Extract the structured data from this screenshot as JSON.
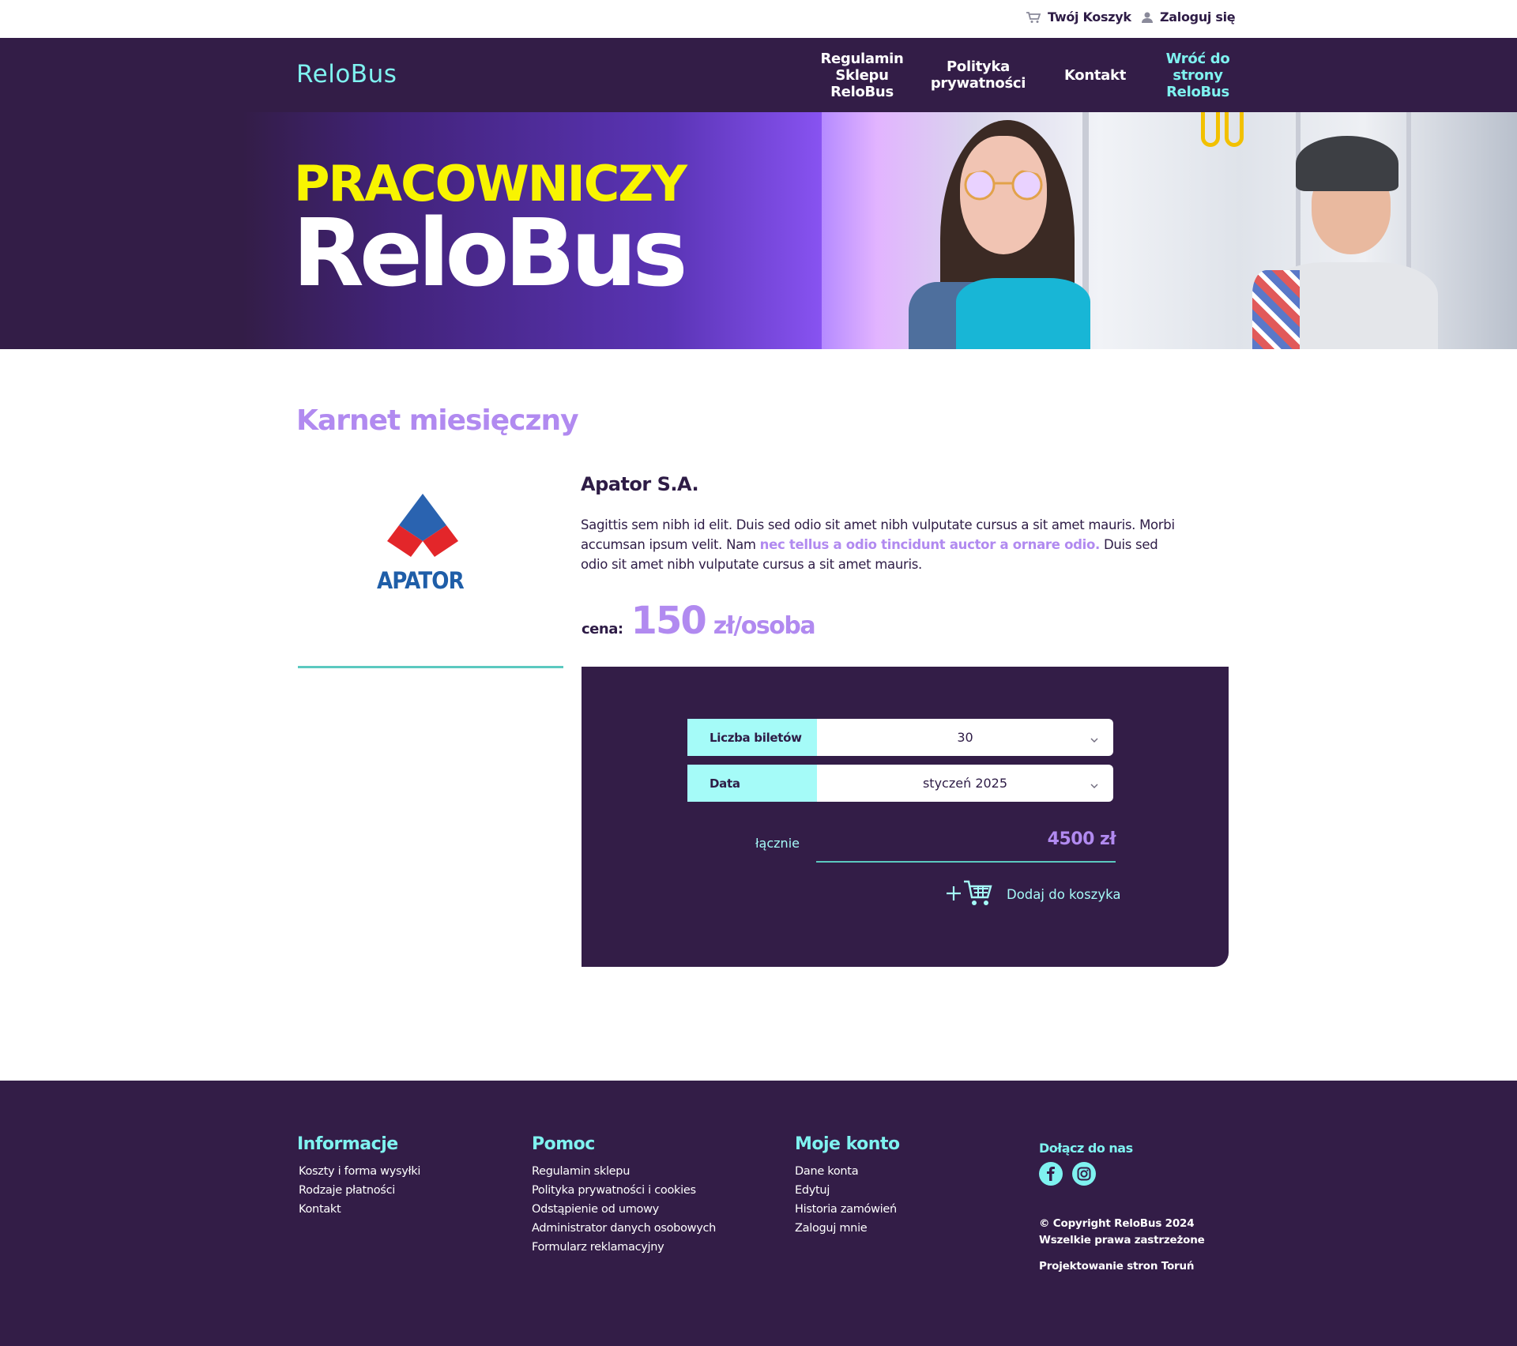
{
  "utility": {
    "cart_label": "Twój Koszyk",
    "login_label": "Zaloguj się"
  },
  "header": {
    "logo": "ReloBus",
    "nav": {
      "regulamin": "Regulamin Sklepu ReloBus",
      "polityka": "Polityka prywatności",
      "kontakt": "Kontakt",
      "wroc": "Wróć do strony ReloBus"
    }
  },
  "hero": {
    "title_top": "PRACOWNICZY",
    "title_main": "ReloBus"
  },
  "product": {
    "section_title": "Karnet miesięczny",
    "company_logo_text": "APATOR",
    "company_name": "Apator S.A.",
    "description_part1": "Sagittis sem nibh id elit. Duis sed odio sit amet nibh vulputate cursus a sit amet mauris. Morbi accumsan ipsum velit. Nam ",
    "description_highlight": "nec tellus a odio tincidunt auctor a ornare odio.",
    "description_part2": " Duis sed odio sit amet nibh vulputate cursus a sit amet mauris.",
    "price_label": "cena:",
    "price_value": "150",
    "price_unit": "zł/osoba"
  },
  "order": {
    "tickets_label": "Liczba biletów",
    "tickets_value": "30",
    "date_label": "Data",
    "date_value": "styczeń 2025",
    "total_label": "łącznie",
    "total_value": "4500 zł",
    "add_to_cart_label": "Dodaj do koszyka"
  },
  "footer": {
    "info": {
      "title": "Informacje",
      "links": [
        "Koszty i forma wysyłki",
        "Rodzaje płatności",
        "Kontakt"
      ]
    },
    "help": {
      "title": "Pomoc",
      "links": [
        "Regulamin sklepu",
        "Polityka prywatności i cookies",
        "Odstąpienie od umowy",
        "Administrator danych osobowych",
        "Formularz reklamacyjny"
      ]
    },
    "account": {
      "title": "Moje konto",
      "links": [
        "Dane konta",
        "Edytuj",
        "Historia zamówień",
        "Zaloguj mnie"
      ]
    },
    "social": {
      "title": "Dołącz do nas",
      "icons": [
        "facebook-icon",
        "instagram-icon"
      ]
    },
    "copyright_line1": "© Copyright ReloBus 2024",
    "copyright_line2": "Wszelkie prawa zastrzeżone",
    "credit": "Projektowanie stron Toruń"
  },
  "colors": {
    "brand_dark": "#331d47",
    "accent_cyan": "#7ff2f0",
    "accent_light_cyan": "#a5fbf8",
    "accent_lavender": "#b18af0",
    "hero_yellow": "#f8f400",
    "divider_teal": "#5bc9c0"
  }
}
